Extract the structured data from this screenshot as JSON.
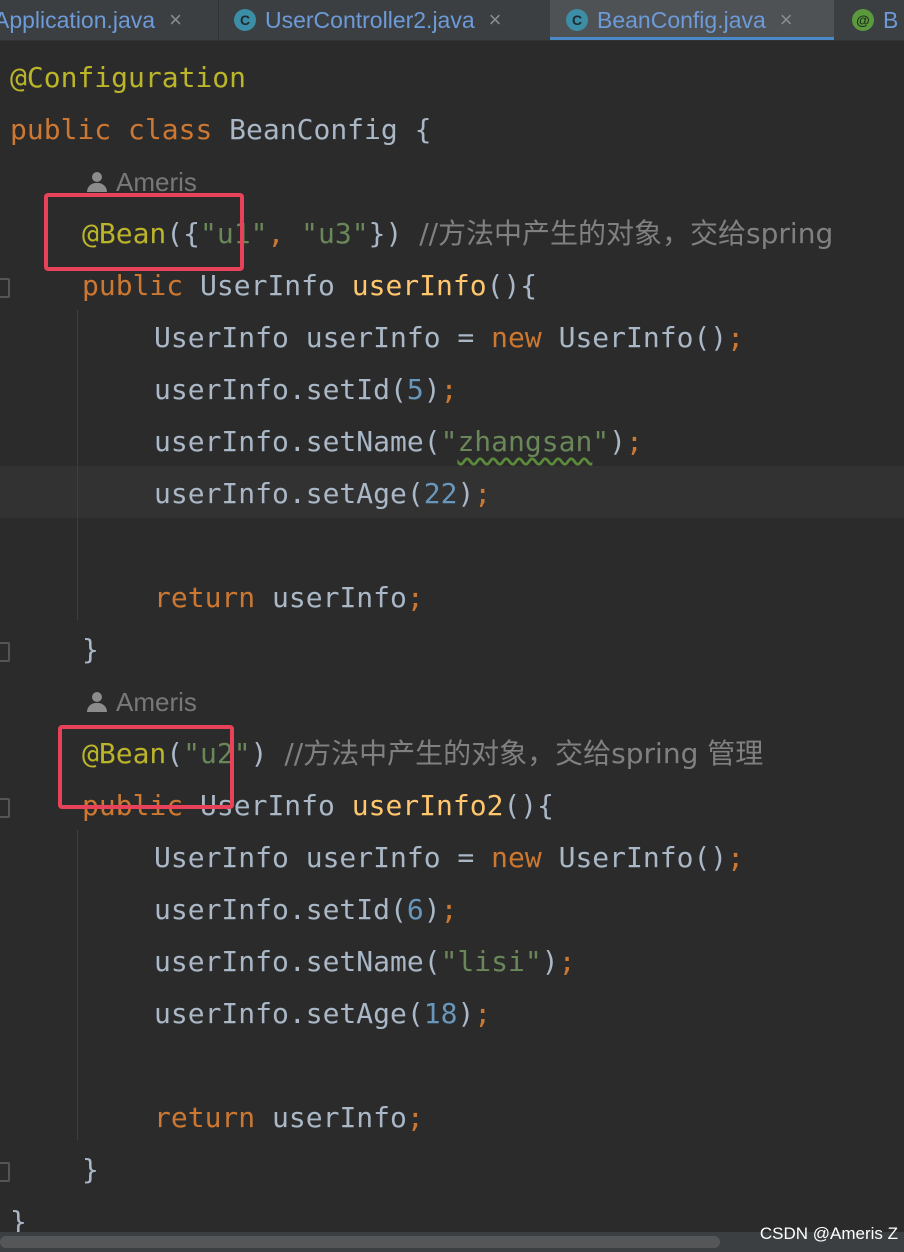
{
  "tabs": [
    {
      "label": "Application.java",
      "icon": "java-class-icon",
      "active": false,
      "close": "×"
    },
    {
      "label": "UserController2.java",
      "icon": "java-class-icon",
      "active": false,
      "close": "×"
    },
    {
      "label": "BeanConfig.java",
      "icon": "java-class-icon",
      "active": true,
      "close": "×"
    },
    {
      "label": "B",
      "icon": "annotation-icon",
      "active": false
    }
  ],
  "tab_icon_letters": {
    "class": "C",
    "annotation": "@"
  },
  "author": "Ameris",
  "editor": {
    "l1": {
      "ann": "@Configuration"
    },
    "l2": {
      "kw1": "public",
      "kw2": "class",
      "name": "BeanConfig",
      "brace": "{"
    },
    "l4": {
      "ann": "@Bean",
      "p1": "({",
      "s1": "\"u1\"",
      "p2": ", ",
      "s2": "\"u3\"",
      "p3": "}) ",
      "comment": "//方法中产生的对象，交给spring"
    },
    "l5": {
      "kw": "public",
      "type": "UserInfo",
      "fn": "userInfo",
      "rest": "(){"
    },
    "l6": {
      "a": "UserInfo userInfo = ",
      "kw": "new",
      "b": " UserInfo()",
      "semi": ";"
    },
    "l7": {
      "a": "userInfo.setId(",
      "num": "5",
      "b": ")",
      "semi": ";"
    },
    "l8": {
      "a": "userInfo.setName(",
      "q1": "\"",
      "str": "zhangsan",
      "q2": "\"",
      "b": ")",
      "semi": ";"
    },
    "l9": {
      "a": "userInfo.setAge(",
      "num": "22",
      "b": ")",
      "semi": ";"
    },
    "l11": {
      "kw": "return",
      "a": " userInfo",
      "semi": ";"
    },
    "l12": {
      "brace": "}"
    },
    "l14": {
      "ann": "@Bean",
      "p1": "(",
      "s1": "\"u2\"",
      "p2": ") ",
      "comment": "//方法中产生的对象，交给spring 管理"
    },
    "l15": {
      "kw": "public",
      "type": "UserInfo",
      "fn": "userInfo2",
      "rest": "(){"
    },
    "l16": {
      "a": "UserInfo userInfo = ",
      "kw": "new",
      "b": " UserInfo()",
      "semi": ";"
    },
    "l17": {
      "a": "userInfo.setId(",
      "num": "6",
      "b": ")",
      "semi": ";"
    },
    "l18": {
      "a": "userInfo.setName(",
      "str": "\"lisi\"",
      "b": ")",
      "semi": ";"
    },
    "l19": {
      "a": "userInfo.setAge(",
      "num": "18",
      "b": ")",
      "semi": ";"
    },
    "l21": {
      "kw": "return",
      "a": " userInfo",
      "semi": ";"
    },
    "l22": {
      "brace": "}"
    },
    "l23": {
      "brace": "}"
    }
  },
  "colors": {
    "background": "#2b2b2b",
    "keyword": "#cc7832",
    "annotation": "#bbb529",
    "string": "#6a8759",
    "number": "#6897bb",
    "function": "#ffc66d",
    "comment": "#808080",
    "highlight_box": "#e8425a"
  },
  "watermark": "CSDN @Ameris Z"
}
